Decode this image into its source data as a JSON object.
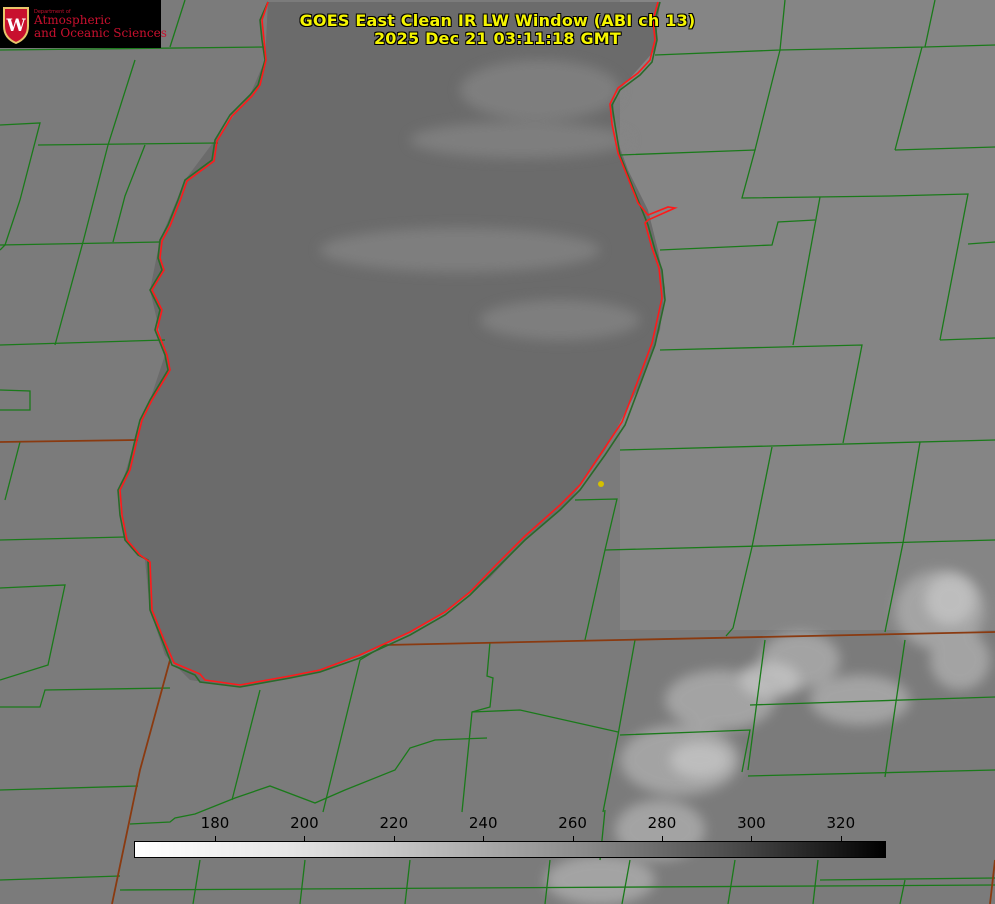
{
  "header": {
    "title_line1": "GOES East Clean IR LW Window (ABI ch 13)",
    "title_line2": "2025 Dec 21 03:11:18 GMT"
  },
  "logo": {
    "department": "Department of",
    "line1": "Atmospheric",
    "line2": "and Oceanic Sciences",
    "emblem_letter": "W"
  },
  "colorbar": {
    "tick_labels": [
      "180",
      "200",
      "220",
      "240",
      "260",
      "280",
      "300",
      "320"
    ],
    "colors": {
      "low": "#ffffff",
      "high": "#000000"
    }
  },
  "map_colors": {
    "county_lines": "#1a7a1a",
    "state_lines": "#8a3a10",
    "coastline": "#ff1a1a",
    "marker": "#d4c000"
  }
}
